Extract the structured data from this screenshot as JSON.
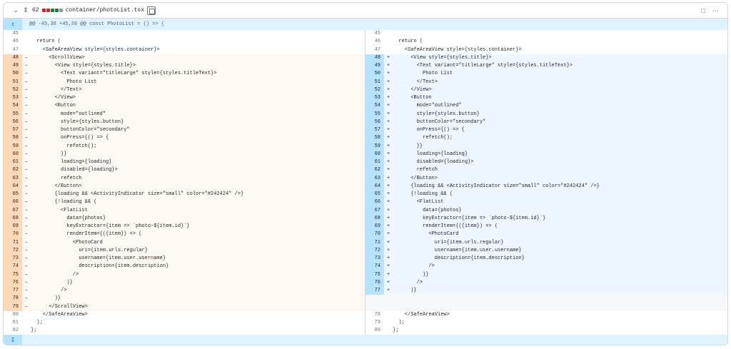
{
  "file": {
    "change_count": "62",
    "name": "container/photoList.tsx",
    "block_colors": [
      "#cf222e",
      "#cf222e",
      "#1a7f37",
      "#1a7f37",
      "#8c959f"
    ]
  },
  "icons": {
    "collapse": "chevron-down-icon",
    "expand": "fold-icon",
    "copy": "copy-icon",
    "comment": "comment-icon",
    "more": "kebab-horizontal-icon",
    "expand_up": "expand-up-icon",
    "expand_down": "expand-down-icon"
  },
  "hunk_header": "@@ -45,38 +45,36 @@ const PhotoList = () => {",
  "left": [
    {
      "n": "45",
      "m": "",
      "c": "",
      "t": "ctx"
    },
    {
      "n": "46",
      "m": "",
      "c": "  return (",
      "t": "ctx"
    },
    {
      "n": "47",
      "m": "",
      "c": "    <SafeAreaView style={styles.container}>",
      "t": "ctx"
    },
    {
      "n": "48",
      "m": "–",
      "c": "      <ScrollView>",
      "t": "del"
    },
    {
      "n": "49",
      "m": "–",
      "c": "        <View style={styles.title}>",
      "t": "del"
    },
    {
      "n": "50",
      "m": "–",
      "c": "          <Text variant=\"titleLarge\" style={styles.titleText}>",
      "t": "del"
    },
    {
      "n": "51",
      "m": "–",
      "c": "            Photo List",
      "t": "del"
    },
    {
      "n": "52",
      "m": "–",
      "c": "          </Text>",
      "t": "del"
    },
    {
      "n": "53",
      "m": "–",
      "c": "        </View>",
      "t": "del"
    },
    {
      "n": "54",
      "m": "–",
      "c": "        <Button",
      "t": "del"
    },
    {
      "n": "55",
      "m": "–",
      "c": "          mode=\"outlined\"",
      "t": "del"
    },
    {
      "n": "56",
      "m": "–",
      "c": "          style={styles.button}",
      "t": "del"
    },
    {
      "n": "57",
      "m": "–",
      "c": "          buttonColor=\"secondary\"",
      "t": "del"
    },
    {
      "n": "58",
      "m": "–",
      "c": "          onPress={() => {",
      "t": "del"
    },
    {
      "n": "59",
      "m": "–",
      "c": "            refetch();",
      "t": "del"
    },
    {
      "n": "60",
      "m": "–",
      "c": "          }}",
      "t": "del"
    },
    {
      "n": "61",
      "m": "–",
      "c": "          loading={loading}",
      "t": "del"
    },
    {
      "n": "62",
      "m": "–",
      "c": "          disabled={loading}>",
      "t": "del"
    },
    {
      "n": "63",
      "m": "–",
      "c": "          refetch",
      "t": "del"
    },
    {
      "n": "64",
      "m": "–",
      "c": "        </Button>",
      "t": "del"
    },
    {
      "n": "65",
      "m": "–",
      "c": "        {loading && <ActivityIndicator size=\"small\" color=\"#242424\" />}",
      "t": "del"
    },
    {
      "n": "66",
      "m": "–",
      "c": "        {!loading && (",
      "t": "del"
    },
    {
      "n": "67",
      "m": "–",
      "c": "          <FlatList",
      "t": "del"
    },
    {
      "n": "68",
      "m": "–",
      "c": "            data={photos}",
      "t": "del"
    },
    {
      "n": "69",
      "m": "–",
      "c": "            keyExtractor={item => `photo-${item.id}`}",
      "t": "del"
    },
    {
      "n": "70",
      "m": "–",
      "c": "            renderItem={({item}) => (",
      "t": "del"
    },
    {
      "n": "71",
      "m": "–",
      "c": "              <PhotoCard",
      "t": "del"
    },
    {
      "n": "72",
      "m": "–",
      "c": "                uri={item.urls.regular}",
      "t": "del"
    },
    {
      "n": "73",
      "m": "–",
      "c": "                username={item.user.username}",
      "t": "del"
    },
    {
      "n": "74",
      "m": "–",
      "c": "                description={item.description}",
      "t": "del"
    },
    {
      "n": "75",
      "m": "–",
      "c": "              />",
      "t": "del"
    },
    {
      "n": "76",
      "m": "–",
      "c": "            )}",
      "t": "del"
    },
    {
      "n": "77",
      "m": "–",
      "c": "          />",
      "t": "del"
    },
    {
      "n": "78",
      "m": "–",
      "c": "        )}",
      "t": "del"
    },
    {
      "n": "79",
      "m": "–",
      "c": "      </ScrollView>",
      "t": "del"
    },
    {
      "n": "80",
      "m": "",
      "c": "    </SafeAreaView>",
      "t": "ctx"
    },
    {
      "n": "81",
      "m": "",
      "c": "  );",
      "t": "ctx"
    },
    {
      "n": "82",
      "m": "",
      "c": "};",
      "t": "ctx"
    }
  ],
  "right": [
    {
      "n": "45",
      "m": "",
      "c": "",
      "t": "ctx"
    },
    {
      "n": "46",
      "m": "",
      "c": "  return (",
      "t": "ctx"
    },
    {
      "n": "47",
      "m": "",
      "c": "    <SafeAreaView style={styles.container}>",
      "t": "ctx"
    },
    {
      "n": "48",
      "m": "+",
      "c": "      <View style={styles.title}>",
      "t": "add"
    },
    {
      "n": "49",
      "m": "+",
      "c": "        <Text variant=\"titleLarge\" style={styles.titleText}>",
      "t": "add"
    },
    {
      "n": "50",
      "m": "+",
      "c": "          Photo List",
      "t": "add"
    },
    {
      "n": "51",
      "m": "+",
      "c": "        </Text>",
      "t": "add"
    },
    {
      "n": "52",
      "m": "+",
      "c": "      </View>",
      "t": "add"
    },
    {
      "n": "53",
      "m": "+",
      "c": "      <Button",
      "t": "add"
    },
    {
      "n": "54",
      "m": "+",
      "c": "        mode=\"outlined\"",
      "t": "add"
    },
    {
      "n": "55",
      "m": "+",
      "c": "        style={styles.button}",
      "t": "add"
    },
    {
      "n": "56",
      "m": "+",
      "c": "        buttonColor=\"secondary\"",
      "t": "add"
    },
    {
      "n": "57",
      "m": "+",
      "c": "        onPress={() => {",
      "t": "add"
    },
    {
      "n": "58",
      "m": "+",
      "c": "          refetch();",
      "t": "add"
    },
    {
      "n": "59",
      "m": "+",
      "c": "        }}",
      "t": "add"
    },
    {
      "n": "60",
      "m": "+",
      "c": "        loading={loading}",
      "t": "add"
    },
    {
      "n": "61",
      "m": "+",
      "c": "        disabled={loading}>",
      "t": "add"
    },
    {
      "n": "62",
      "m": "+",
      "c": "        refetch",
      "t": "add"
    },
    {
      "n": "63",
      "m": "+",
      "c": "      </Button>",
      "t": "add"
    },
    {
      "n": "64",
      "m": "+",
      "c": "      {loading && <ActivityIndicator size=\"small\" color=\"#242424\" />}",
      "t": "add"
    },
    {
      "n": "65",
      "m": "+",
      "c": "      {!loading && (",
      "t": "add"
    },
    {
      "n": "66",
      "m": "+",
      "c": "        <FlatList",
      "t": "add"
    },
    {
      "n": "67",
      "m": "+",
      "c": "          data={photos}",
      "t": "add"
    },
    {
      "n": "68",
      "m": "+",
      "c": "          keyExtractor={item => `photo-${item.id}`}",
      "t": "add"
    },
    {
      "n": "69",
      "m": "+",
      "c": "          renderItem={({item}) => (",
      "t": "add"
    },
    {
      "n": "70",
      "m": "+",
      "c": "            <PhotoCard",
      "t": "add"
    },
    {
      "n": "71",
      "m": "+",
      "c": "              uri={item.urls.regular}",
      "t": "add"
    },
    {
      "n": "72",
      "m": "+",
      "c": "              username={item.user.username}",
      "t": "add"
    },
    {
      "n": "73",
      "m": "+",
      "c": "              description={item.description}",
      "t": "add"
    },
    {
      "n": "74",
      "m": "+",
      "c": "            />",
      "t": "add"
    },
    {
      "n": "75",
      "m": "+",
      "c": "          )}",
      "t": "add"
    },
    {
      "n": "76",
      "m": "+",
      "c": "        />",
      "t": "add"
    },
    {
      "n": "77",
      "m": "+",
      "c": "      )}",
      "t": "add"
    },
    {
      "n": "",
      "m": "",
      "c": "",
      "t": "blank"
    },
    {
      "n": "",
      "m": "",
      "c": "",
      "t": "blank"
    },
    {
      "n": "78",
      "m": "",
      "c": "    </SafeAreaView>",
      "t": "ctx"
    },
    {
      "n": "79",
      "m": "",
      "c": "  );",
      "t": "ctx"
    },
    {
      "n": "80",
      "m": "",
      "c": "};",
      "t": "ctx"
    }
  ]
}
